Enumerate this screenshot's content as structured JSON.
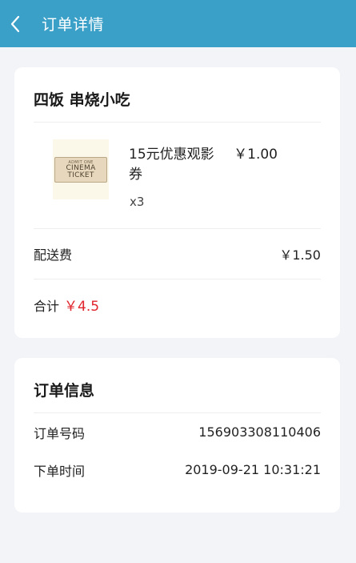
{
  "header": {
    "title": "订单详情"
  },
  "shop": {
    "name": "四饭 串烧小吃",
    "item": {
      "name": "15元优惠观影券",
      "price": "￥1.00",
      "quantity": "x3",
      "thumbnail_text_top": "ADMIT ONE",
      "thumbnail_text_main_1": "CINEMA",
      "thumbnail_text_main_2": "TICKET"
    },
    "delivery": {
      "label": "配送费",
      "value": "￥1.50"
    },
    "total": {
      "label": "合计",
      "value": "￥4.5"
    }
  },
  "order_info": {
    "title": "订单信息",
    "number_label": "订单号码",
    "number_value": "156903308110406",
    "time_label": "下单时间",
    "time_value": "2019-09-21 10:31:21"
  },
  "colors": {
    "header_bg": "#3aa0c8",
    "accent_red": "#e0252c",
    "page_bg": "#f3f4f8"
  },
  "icons": {
    "back": "chevron-left-icon"
  }
}
